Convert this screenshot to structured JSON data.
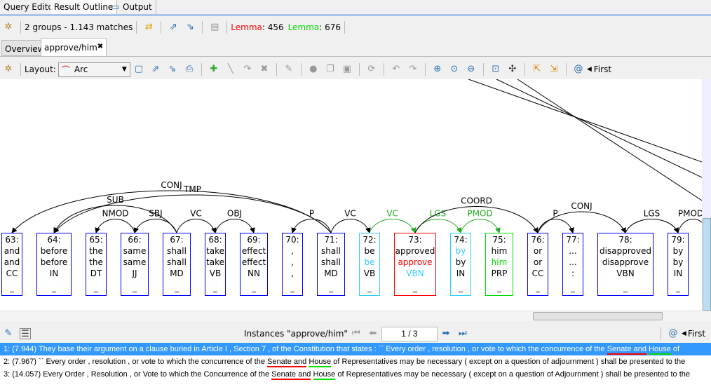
{
  "top_tabs": [
    "Query Editor",
    "Result Outline",
    "Output"
  ],
  "toolbar1": {
    "summary": "2 groups - 1.143 matches",
    "lemma1_label": "Lemma",
    "lemma1_value": ": 456",
    "lemma2_label": "Lemma",
    "lemma2_value": ": 676",
    "lemma1_color": "#ff0000",
    "lemma2_color": "#00dd00"
  },
  "tabs2": [
    "Overview",
    "approve/him"
  ],
  "toolbar2": {
    "layout_label": "Layout:",
    "layout_value": "Arc",
    "first_label": "First"
  },
  "nodes": [
    {
      "id": "63:",
      "word": "and",
      "lemma": "and",
      "pos": "CC",
      "feat": "_"
    },
    {
      "id": "64:",
      "word": "before",
      "lemma": "before",
      "pos": "IN",
      "feat": "_"
    },
    {
      "id": "65:",
      "word": "the",
      "lemma": "the",
      "pos": "DT",
      "feat": "_"
    },
    {
      "id": "66:",
      "word": "same",
      "lemma": "same",
      "pos": "JJ",
      "feat": "_"
    },
    {
      "id": "67:",
      "word": "shall",
      "lemma": "shall",
      "pos": "MD",
      "feat": "_"
    },
    {
      "id": "68:",
      "word": "take",
      "lemma": "take",
      "pos": "VB",
      "feat": "_"
    },
    {
      "id": "69:",
      "word": "effect",
      "lemma": "effect",
      "pos": "NN",
      "feat": "_"
    },
    {
      "id": "70:",
      "word": ",",
      "lemma": ",",
      "pos": ",",
      "feat": "_"
    },
    {
      "id": "71:",
      "word": "shall",
      "lemma": "shall",
      "pos": "MD",
      "feat": "_"
    },
    {
      "id": "72:",
      "word": "be",
      "lemma": "be",
      "pos": "VB",
      "feat": "_",
      "border": "#33ccff",
      "lemma_color": "#33ccff"
    },
    {
      "id": "73:",
      "word": "approved",
      "lemma": "approve",
      "pos": "VBN",
      "feat": "_",
      "border": "#ff0000",
      "lemma_color": "#ff0000",
      "pos_color": "#33ccff"
    },
    {
      "id": "74:",
      "word": "by",
      "lemma": "by",
      "pos": "IN",
      "feat": "_",
      "border": "#33ccff",
      "word_color": "#33ccff"
    },
    {
      "id": "75:",
      "word": "him",
      "lemma": "him",
      "pos": "PRP",
      "feat": "_",
      "border": "#00dd00",
      "lemma_color": "#00dd00"
    },
    {
      "id": "76:",
      "word": "or",
      "lemma": "or",
      "pos": "CC",
      "feat": "_"
    },
    {
      "id": "77:",
      "word": "...",
      "lemma": "...",
      "pos": ":",
      "feat": "_"
    },
    {
      "id": "78:",
      "word": "disapproved",
      "lemma": "disapprove",
      "pos": "VBN",
      "feat": "_"
    },
    {
      "id": "79:",
      "word": "by",
      "lemma": "by",
      "pos": "IN",
      "feat": "_"
    }
  ],
  "arcs": [
    {
      "from": "71:",
      "to": "63:",
      "label": "CONJ"
    },
    {
      "from": "71:",
      "to": "64:",
      "label": "TMP"
    },
    {
      "from": "67:",
      "to": "64:",
      "label": "SUB"
    },
    {
      "from": "66:",
      "to": "65:",
      "label": "NMOD"
    },
    {
      "from": "67:",
      "to": "66:",
      "label": "SBJ"
    },
    {
      "from": "67:",
      "to": "68:",
      "label": "VC"
    },
    {
      "from": "68:",
      "to": "69:",
      "label": "OBJ"
    },
    {
      "from": "71:",
      "to": "70:",
      "label": "P"
    },
    {
      "from": "71:",
      "to": "72:",
      "label": "VC"
    },
    {
      "from": "72:",
      "to": "73:",
      "label": "VC",
      "color": "#22aa22"
    },
    {
      "from": "73:",
      "to": "74:",
      "label": "LGS",
      "color": "#22aa22"
    },
    {
      "from": "74:",
      "to": "75:",
      "label": "PMOD",
      "color": "#22aa22"
    },
    {
      "from": "73:",
      "to": "76:",
      "label": "COORD"
    },
    {
      "from": "76:",
      "to": "77:",
      "label": "P"
    },
    {
      "from": "76:",
      "to": "78:",
      "label": "CONJ"
    },
    {
      "from": "78:",
      "to": "79:",
      "label": "LGS"
    },
    {
      "from": "79:",
      "to": "",
      "label": "PMOD"
    }
  ],
  "bottom": {
    "instances_label": "Instances \"approve/him\"",
    "page": "1 / 3",
    "first_label": "First"
  },
  "sentences": [
    {
      "segments": [
        {
          "t": "1: (7.944) They base their argument on a clause buried in Article I , Section 7 , of the Constitution that states : `` Every order , resolution , or vote to which the concurrence of the "
        },
        {
          "t": "Senate and",
          "mark": "#ff0000"
        },
        {
          "t": " "
        },
        {
          "t": "House",
          "mark": "#00dd00"
        },
        {
          "t": " of"
        }
      ]
    },
    {
      "segments": [
        {
          "t": "2: (7.967) `` Every order , resolution , or vote to which the concurrence of the "
        },
        {
          "t": "Senate and",
          "mark": "#ff0000"
        },
        {
          "t": " "
        },
        {
          "t": "House",
          "mark": "#00dd00"
        },
        {
          "t": " of Representatives may be necessary ( except on a question of adjournment ) shall be presented to the"
        }
      ]
    },
    {
      "segments": [
        {
          "t": "3: (14.057) Every Order , Resolution , or Vote to which the Concurrence of the "
        },
        {
          "t": "Senate and",
          "mark": "#ff0000"
        },
        {
          "t": " "
        },
        {
          "t": "House",
          "mark": "#00dd00"
        },
        {
          "t": " of Representatives may be necessary ( except on a question of Adjournment ) shall be presented to the"
        }
      ]
    }
  ]
}
